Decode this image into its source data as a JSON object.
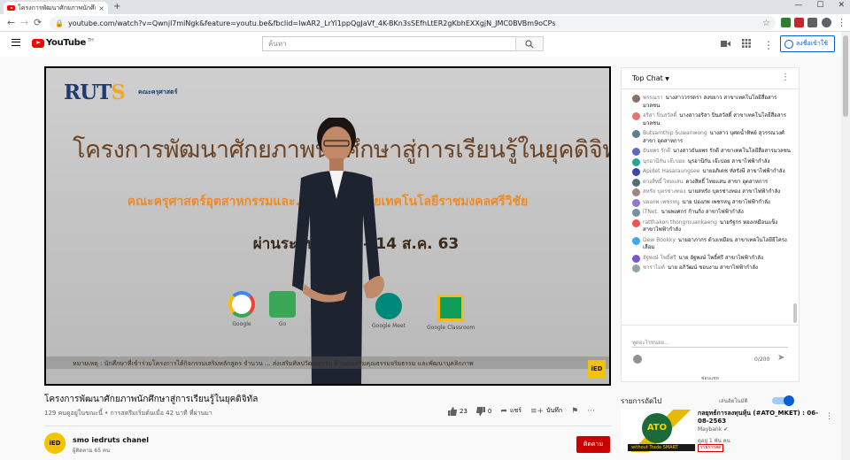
{
  "browser": {
    "tab_title": "โครงการพัฒนาศักยภาพนักศึกษา",
    "tab_close": "×",
    "new_tab": "+",
    "window_controls": [
      "—",
      "☐",
      "✕"
    ],
    "url": "youtube.com/watch?v=Qwnjl7miNgk&feature=youtu.be&fbclid=IwAR2_LrYi1ppQgJaVf_4K-BKn3sSEfhLtER2gKbhEXXgjN_JMC0BVBm9oCPs",
    "back": "←",
    "forward": "→",
    "reload": "⟳",
    "star": "☆",
    "more": "⋮"
  },
  "youtube": {
    "logo_text": "YouTube",
    "logo_sup": "TH",
    "search_placeholder": "ค้นหา",
    "signin_label": "ลงชื่อเข้าใช้"
  },
  "video": {
    "logo_main": "RUT",
    "logo_s": "S",
    "logo_sub": "คณะครุศาสตร์",
    "line1": "โครงการพัฒนาศักยภาพนักศึกษาสู่การเรียนรู้ในยุคดิจิทัล",
    "line2": "คณะครุศาสตร์อุตสาหกรรมและ... มหาวิทยาลัยเทคโนโลยีราชมงคลศรีวิชัย",
    "line3": "ผ่านระบบอ...   6 – 14 ส.ค. 63",
    "apps": [
      {
        "name": "Google",
        "color": "#ffffff"
      },
      {
        "name": "Go",
        "color": "#3aa757"
      },
      {
        "name": "Google Meet",
        "color": "#00897b"
      },
      {
        "name": "Google Classroom",
        "color": "#f6bb18"
      }
    ],
    "note": "หมายเหตุ : นักศึกษาที่เข้าร่วมโครงการได้กิจกรรมเสริมหลักสูตร จำนวน ... ส่งเสริมศิลปวัฒนธรรม ด้านส่งเสริมคุณธรรมจริยธรรม และพัฒนาบุคลิกภาพ",
    "badge": "iED"
  },
  "info": {
    "title": "โครงการพัฒนาศักยภาพนักศึกษาสู่การเรียนรู้ในยุคดิจิทัล",
    "meta": "129 คนดูอยู่ในขณะนี้ • การสตรีมเริ่มต้นเมื่อ 42 นาที ที่ผ่านมา",
    "likes": "23",
    "dislikes": "0",
    "share": "แชร์",
    "save": "บันทึก",
    "channel_name": "smo iedruts chanel",
    "channel_subs": "ผู้ติดตาม 65 คน",
    "channel_avatar": "iED",
    "subscribe": "ติดตาม"
  },
  "chat": {
    "header": "Top Chat",
    "messages": [
      {
        "name": "พรรณรา",
        "text": "นางสาววรรดรา สงขยาว สาขาเทคโนโลยีสื่อสารมวลชน",
        "color": "#8d6e63"
      },
      {
        "name": "อริสา ปิ่นสวัสดิ์",
        "text": "นางสาวอริสา ปิ่นสวัสดิ์ สาขาเทคโนโลยีสื่อสารมวลชน",
        "color": "#e57373"
      },
      {
        "name": "Butsamthip Suwanwong",
        "text": "นางสาว บุศดน้ำทิพย์ สุวรรณวงศ์ สาขา อุตสาหการ",
        "color": "#607d8b"
      },
      {
        "name": "ธันยพร รักดี",
        "text": "นางสาวธันยพร รักดี สาขาเทคโนโลยีสื่อสารมวลชน",
        "color": "#5c6bc0"
      },
      {
        "name": "นุรอานีกัน เจ๊ะบ่อย",
        "text": "นุรอานีกัน เจ๊ะบ่อย สาขาไฟฟ้ากำลัง",
        "color": "#26a69a"
      },
      {
        "name": "Apidet Hasaraungsee",
        "text": "นายอภิเดช หัสรังษี สาขาไฟฟ้ากำลัง",
        "color": "#3949ab"
      },
      {
        "name": "ดวงสิทธิ์ ไทยแสน",
        "text": "ดวงสิทธิ์ ไทยแสน สาขา อุตสาหการ",
        "color": "#546e7a"
      },
      {
        "name": "สหรัถ บุตรช่างทอง",
        "text": "นายสหรัถ บุตรช่างทอง สาขาไฟฟ้ากำลัง",
        "color": "#a1887f"
      },
      {
        "name": "ปองภพ เพชรหนู",
        "text": "นาย ปองภพ เพชรหนู สาขาไฟฟ้ากำลัง",
        "color": "#9575cd"
      },
      {
        "name": "iTNet.",
        "text": "นายพงศกร ก้านกิ่ง สาขาไฟฟ้ากำลัง",
        "color": "#78909c"
      },
      {
        "name": "ratthakon thongmuankaeng",
        "text": "นายรัฐกร ทองเหมือนแข็ง สาขาไฟฟ้ากำลัง",
        "color": "#ef5350"
      },
      {
        "name": "Dew Bookky",
        "text": "นายอาภากร ด้วงเหมือน สาขาเทคโนโลยียีโครงเลือม",
        "color": "#42a5f5"
      },
      {
        "name": "อัฐพงษ์ โพธิ์ศรี",
        "text": "นาย อัฐพงษ์ โพธิ์ศรี สาขาไฟฟ้ากำลัง",
        "color": "#7e57c2"
      },
      {
        "name": "ชาราไมค์",
        "text": "นาย อภิวัฒน์ ชอบงาม สาขาไฟฟ้ากำลัง",
        "color": "#90a4ae"
      }
    ],
    "input_placeholder": "พูดอะไรหน่อย...",
    "counter": "0/200",
    "hide": "ซ่อนแชท"
  },
  "upnext": {
    "label": "รายการถัดไป",
    "autoplay": "เล่นอัตโนมัติ",
    "thumb_text": "ATO",
    "thumb_tag": "without Trade SMART",
    "title": "กลยุทธ์การลงทุนหุ้น (#ATO_MKET) : 06-08-2563",
    "channel": "Maybank",
    "views": "ดูอยู่ 1 พัน คน",
    "badge": "รายการสด"
  }
}
